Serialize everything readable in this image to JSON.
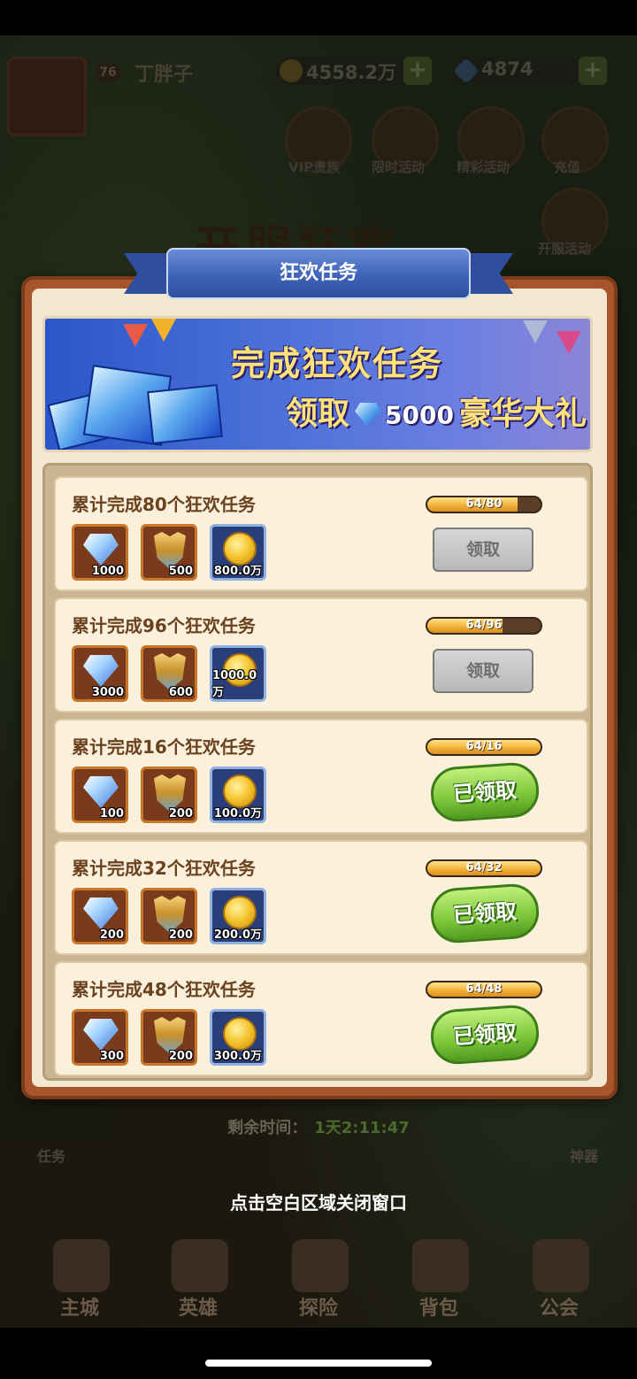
{
  "hud": {
    "level": "76",
    "player_name": "丁胖子",
    "gold": "4558.2万",
    "gems": "4874",
    "plus": "+",
    "menu": [
      "VIP贵族",
      "限时活动",
      "精彩活动",
      "充值",
      "开服活动"
    ],
    "festival_title": "开服狂欢"
  },
  "modal": {
    "title": "狂欢任务",
    "banner": {
      "line1": "完成狂欢任务",
      "line2_prefix": "领取",
      "amount": "5000",
      "line2_suffix": "豪华大礼"
    },
    "tasks": [
      {
        "title": "累计完成80个狂欢任务",
        "rewards": [
          "1000",
          "500",
          "800.0万"
        ],
        "progress_text": "64/80",
        "progress": 0.8,
        "status": "领取",
        "claimed": false
      },
      {
        "title": "累计完成96个狂欢任务",
        "rewards": [
          "3000",
          "600",
          "1000.0万"
        ],
        "progress_text": "64/96",
        "progress": 0.667,
        "status": "领取",
        "claimed": false
      },
      {
        "title": "累计完成16个狂欢任务",
        "rewards": [
          "100",
          "200",
          "100.0万"
        ],
        "progress_text": "64/16",
        "progress": 1.0,
        "status": "已领取",
        "claimed": true
      },
      {
        "title": "累计完成32个狂欢任务",
        "rewards": [
          "200",
          "200",
          "200.0万"
        ],
        "progress_text": "64/32",
        "progress": 1.0,
        "status": "已领取",
        "claimed": true
      },
      {
        "title": "累计完成48个狂欢任务",
        "rewards": [
          "300",
          "200",
          "300.0万"
        ],
        "progress_text": "64/48",
        "progress": 1.0,
        "status": "已领取",
        "claimed": true
      }
    ]
  },
  "footer": {
    "timer_label": "剩余时间：",
    "timer_value": "1天2:11:47",
    "close_hint": "点击空白区域关闭窗口",
    "side_left": "任务",
    "side_right": "神器"
  },
  "bottom_nav": [
    "主城",
    "英雄",
    "探险",
    "背包",
    "公会"
  ],
  "colors": {
    "accent_blue": "#3e63b8",
    "panel": "#f4e8d0",
    "frame": "#a8552b",
    "claimed_green": "#7ec63a"
  }
}
